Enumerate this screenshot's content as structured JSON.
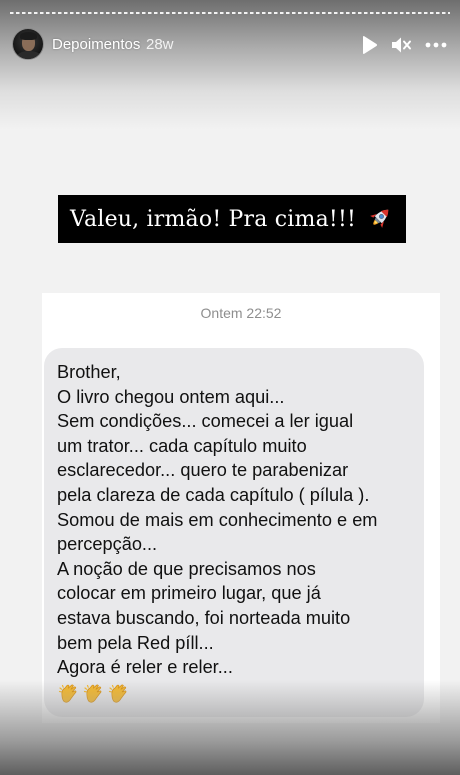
{
  "story": {
    "username": "Depoimentos",
    "time_ago": "28w",
    "progress_segments": 1
  },
  "controls": {
    "play_icon": "play-icon",
    "mute_icon": "mute-icon",
    "more_icon": "more-options-icon"
  },
  "caption": {
    "text": "Valeu, irmão! Pra cima!!!",
    "emoji": "rocket-icon"
  },
  "chat": {
    "timestamp": "Ontem 22:52",
    "lines": [
      "Brother,",
      "O livro chegou ontem aqui...",
      "Sem condições... comecei a ler igual",
      "um trator... cada capítulo muito",
      "esclarecedor... quero te parabenizar",
      "pela clareza de cada capítulo ( pílula ).",
      "Somou de mais em conhecimento e em",
      "percepção...",
      "A noção de que precisamos nos",
      "colocar em primeiro lugar, que já",
      "estava buscando,  foi norteada muito",
      "bem pela Red píll...",
      "Agora é reler e reler..."
    ],
    "emojis": [
      "clapping-hands-icon",
      "clapping-hands-icon",
      "clapping-hands-icon"
    ]
  },
  "colors": {
    "bubble": "#e9e9eb",
    "caption_bg": "#000000",
    "caption_text": "#ffffff",
    "timestamp": "#8e8e8e"
  }
}
